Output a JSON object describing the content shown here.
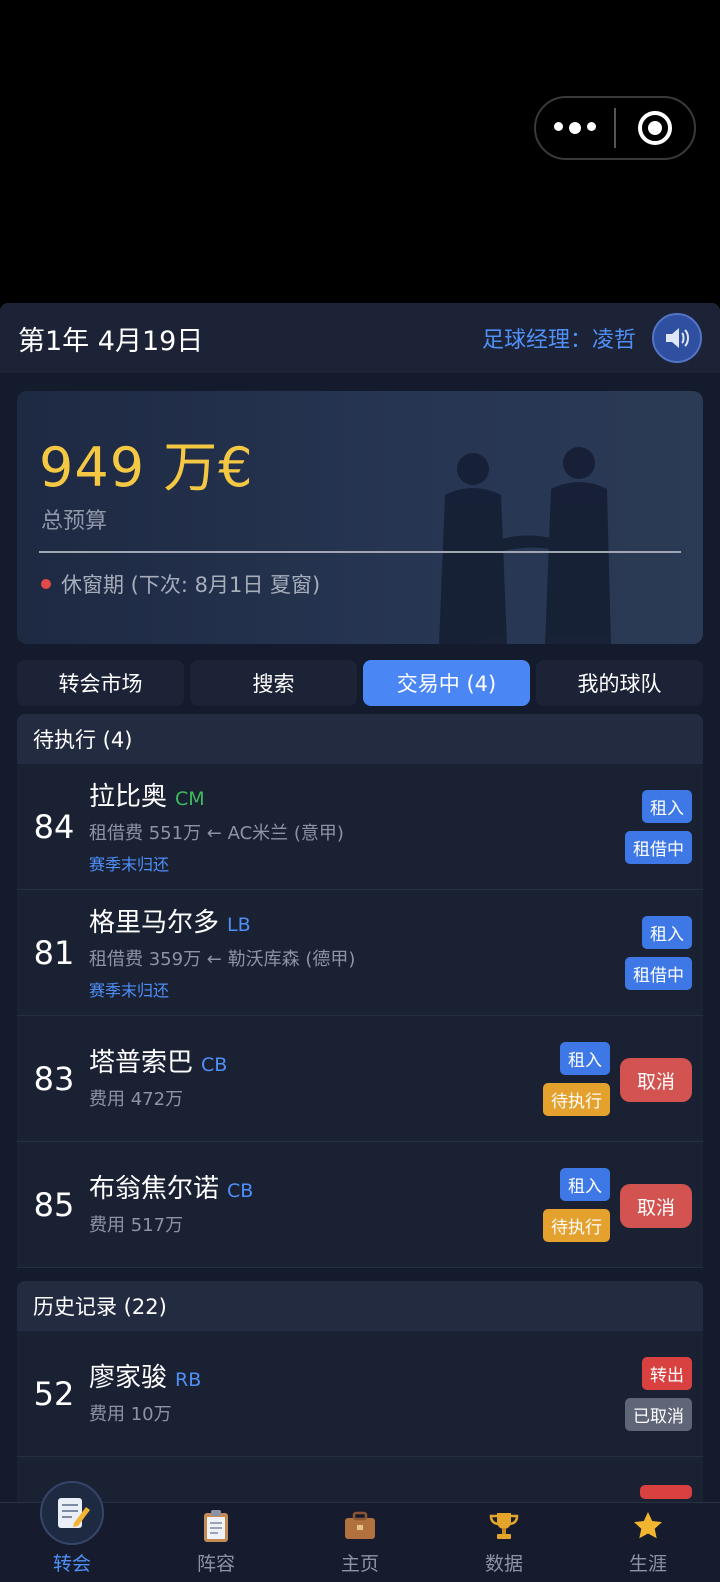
{
  "header": {
    "date": "第1年 4月19日",
    "manager": "足球经理：凌哲"
  },
  "budget": {
    "amount": "949 万€",
    "label": "总预算",
    "status": "休窗期 (下次: 8月1日 夏窗)"
  },
  "tabs": [
    "转会市场",
    "搜索",
    "交易中 (4)",
    "我的球队"
  ],
  "pending": {
    "title": "待执行 (4)",
    "rows": [
      {
        "ovr": "84",
        "name": "拉比奥",
        "pos": "CM",
        "pos_color": "#3dbb5e",
        "fee": "租借费 551万 ← AC米兰 (意甲)",
        "note": "赛季末归还",
        "badge1": "租入",
        "badge2": "租借中"
      },
      {
        "ovr": "81",
        "name": "格里马尔多",
        "pos": "LB",
        "pos_color": "#4f8ff7",
        "fee": "租借费 359万 ← 勒沃库森 (德甲)",
        "note": "赛季末归还",
        "badge1": "租入",
        "badge2": "租借中"
      },
      {
        "ovr": "83",
        "name": "塔普索巴",
        "pos": "CB",
        "pos_color": "#4f8ff7",
        "fee": "费用 472万",
        "badge1": "租入",
        "badge2": "待执行",
        "action": "取消"
      },
      {
        "ovr": "85",
        "name": "布翁焦尔诺",
        "pos": "CB",
        "pos_color": "#4f8ff7",
        "fee": "费用 517万",
        "badge1": "租入",
        "badge2": "待执行",
        "action": "取消"
      }
    ]
  },
  "history": {
    "title": "历史记录 (22)",
    "rows": [
      {
        "ovr": "52",
        "name": "廖家骏",
        "pos": "RB",
        "pos_color": "#4f8ff7",
        "fee": "费用 10万",
        "badge1": "转出",
        "badge2": "已取消"
      }
    ]
  },
  "nav": [
    "转会",
    "阵容",
    "主页",
    "数据",
    "生涯"
  ]
}
